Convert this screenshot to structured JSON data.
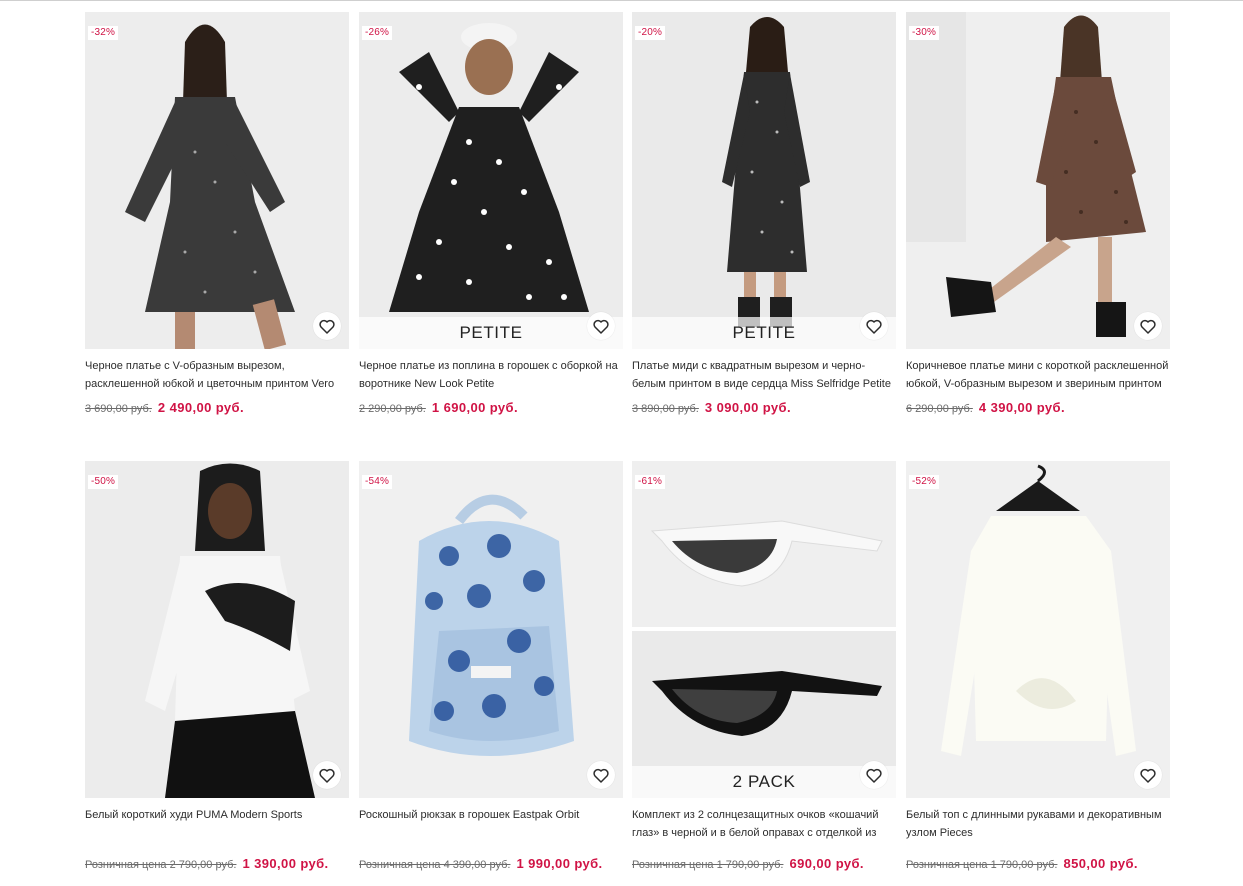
{
  "products": [
    {
      "discount": "-32%",
      "title": "Черное платье с V-образным вырезом, расклешенной юбкой и цветочным принтом Vero Moda",
      "old_price": "3 690,00 руб.",
      "new_price": "2 490,00 руб.",
      "image": "woman-in-black-floral-wrap-dress"
    },
    {
      "discount": "-26%",
      "title": "Черное платье из поплина в горошек с оборкой на воротнике New Look Petite",
      "old_price": "2 290,00 руб.",
      "new_price": "1 690,00 руб.",
      "overlay": "PETITE",
      "image": "woman-in-polka-dot-smock-dress"
    },
    {
      "discount": "-20%",
      "title": "Платье миди с квадратным вырезом и черно-белым принтом в виде сердца Miss Selfridge Petite",
      "old_price": "3 890,00 руб.",
      "new_price": "3 090,00 руб.",
      "overlay": "PETITE",
      "image": "woman-in-heart-print-midi-dress"
    },
    {
      "discount": "-30%",
      "title": "Коричневое платье мини с короткой расклешенной юбкой, V-образным вырезом и звериным принтом",
      "old_price": "6 290,00 руб.",
      "new_price": "4 390,00 руб.",
      "image": "woman-in-brown-animal-print-dress"
    },
    {
      "discount": "-50%",
      "title": "Белый короткий худи PUMA Modern Sports",
      "old_price": "Розничная цена 2 790,00 руб.",
      "new_price": "1 390,00 руб.",
      "image": "woman-in-white-puma-hoodie"
    },
    {
      "discount": "-54%",
      "title": "Роскошный рюкзак в горошек Eastpak Orbit",
      "old_price": "Розничная цена 4 390,00 руб.",
      "new_price": "1 990,00 руб.",
      "image": "blue-polka-dot-backpack"
    },
    {
      "discount": "-61%",
      "title": "Комплект из 2 солнцезащитных очков «кошачий глаз» в черной и в белой оправах с отделкой из",
      "old_price": "Розничная цена 1 790,00 руб.",
      "new_price": "690,00 руб.",
      "overlay": "2 PACK",
      "image": "cat-eye-sunglasses-pack"
    },
    {
      "discount": "-52%",
      "title": "Белый топ с длинными рукавами и декоративным узлом Pieces",
      "old_price": "Розничная цена 1 790,00 руб.",
      "new_price": "850,00 руб.",
      "image": "white-long-sleeve-knot-top"
    }
  ],
  "colors": {
    "sale": "#d01345",
    "text": "#2d2d2d",
    "muted": "#6b6b6b",
    "image_bg": "#f1f1f1"
  },
  "icons": {
    "wishlist": "heart-outline-icon"
  }
}
